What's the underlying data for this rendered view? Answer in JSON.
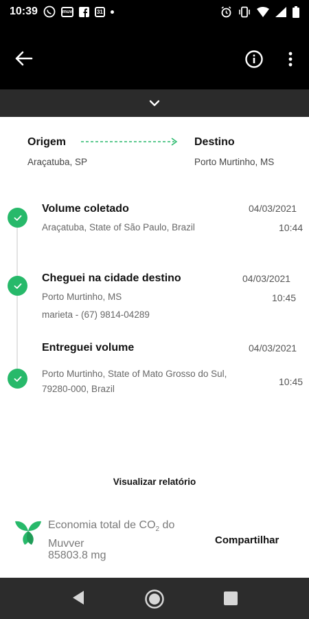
{
  "status_bar": {
    "time": "10:39",
    "icons_left": [
      "whatsapp-icon",
      "muv-icon",
      "facebook-icon",
      "calendar-icon",
      "dot-icon"
    ],
    "calendar_day": "31",
    "muv_text": "muv"
  },
  "app_bar": {
    "back_icon": "arrow-left-icon",
    "info_icon": "info-icon",
    "menu_icon": "more-vert-icon"
  },
  "route": {
    "origin_label": "Origem",
    "origin_city": "Araçatuba, SP",
    "dest_label": "Destino",
    "dest_city": "Porto Murtinho, MS"
  },
  "events": [
    {
      "title": "Volume coletado",
      "lines": [
        "Araçatuba, State of São Paulo, Brazil"
      ],
      "date": "04/03/2021",
      "time": "10:44"
    },
    {
      "title": "Cheguei na cidade destino",
      "lines": [
        "Porto Murtinho, MS",
        "marieta - (67) 9814-04289"
      ],
      "date": "04/03/2021",
      "time": "10:45"
    },
    {
      "title": "Entreguei volume",
      "lines": [
        "Porto Murtinho, State of Mato Grosso do Sul,",
        "79280-000, Brazil"
      ],
      "date": "04/03/2021",
      "time": "10:45"
    }
  ],
  "report_label": "Visualizar relatório",
  "eco": {
    "text_before": "Economia total de CO",
    "text_sub": "2",
    "text_after": " do Muvver",
    "value": "85803.8 mg",
    "share_label": "Compartilhar"
  },
  "colors": {
    "accent_green": "#27b96a",
    "app_bar": "#000000",
    "collapse_bar": "#2b2b2b",
    "nav_bar": "#2c2c2c"
  }
}
